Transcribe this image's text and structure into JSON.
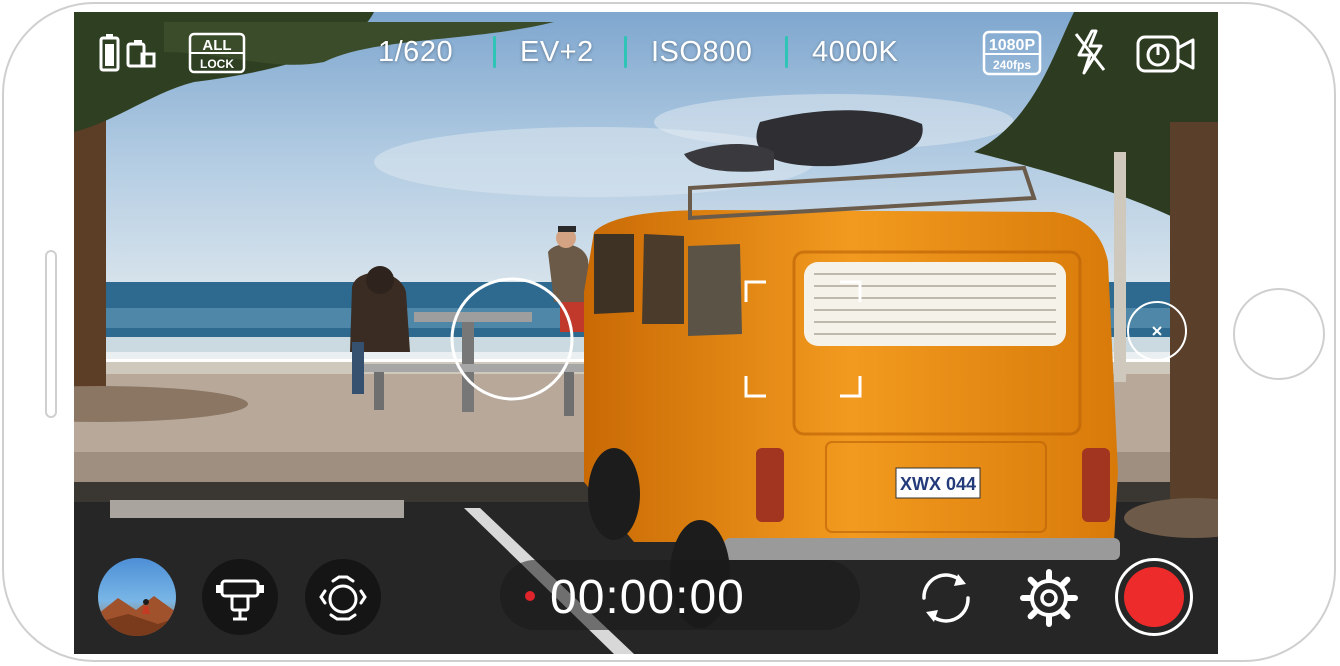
{
  "camera": {
    "battery_icon": "battery-icon",
    "grid_icon": "grid-mode-icon",
    "lock": {
      "line1": "ALL",
      "line2": "LOCK"
    },
    "shutter": "1/620",
    "ev": "EV+2",
    "iso": "ISO800",
    "white_balance": "4000K",
    "resolution": {
      "line1": "1080P",
      "line2": "240fps"
    },
    "flash_icon": "flash-off-icon",
    "timer_icon": "self-timer-icon",
    "focus_icon": "focus-ring-icon",
    "exposure_icon": "exposure-frame-icon",
    "close_icon": "close-icon",
    "bottom": {
      "gallery_icon": "gallery-thumbnail",
      "gimbal_icon": "gimbal-icon",
      "modes_icon": "camera-modes-icon",
      "recording_time": "00:00:00",
      "flip_icon": "switch-camera-icon",
      "settings_icon": "gear-icon",
      "record_icon": "record-button"
    }
  },
  "colors": {
    "accent": "#2ec4b6",
    "record": "#ee2b2b",
    "recording_dot": "#e0242b",
    "sky": "#a9c9e6",
    "sea": "#2e6a8f",
    "van_orange": "#ea8a13",
    "ground": "#262626"
  }
}
